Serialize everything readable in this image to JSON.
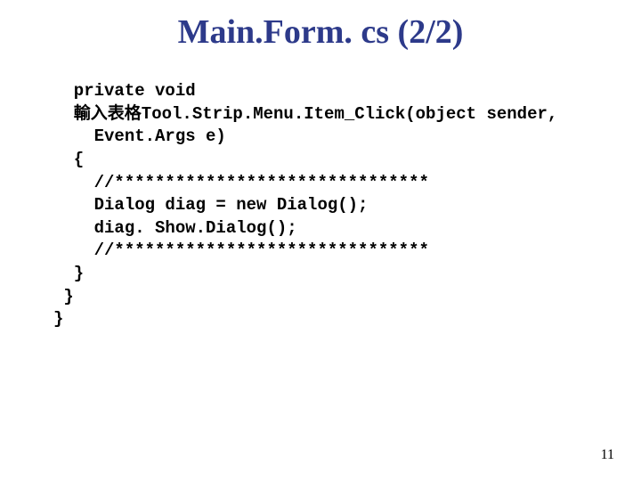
{
  "title": "Main.Form. cs (2/2)",
  "code": {
    "l1": "  private void",
    "l2": "  輸入表格Tool.Strip.Menu.Item_Click(object sender,",
    "l3": "    Event.Args e)",
    "l4": "  {",
    "l5": "    //*******************************",
    "l6": "    Dialog diag = new Dialog();",
    "l7": "    diag. Show.Dialog();",
    "l8": "    //*******************************",
    "l9": "  }",
    "l10": " }",
    "l11": "}"
  },
  "page_number": "11"
}
